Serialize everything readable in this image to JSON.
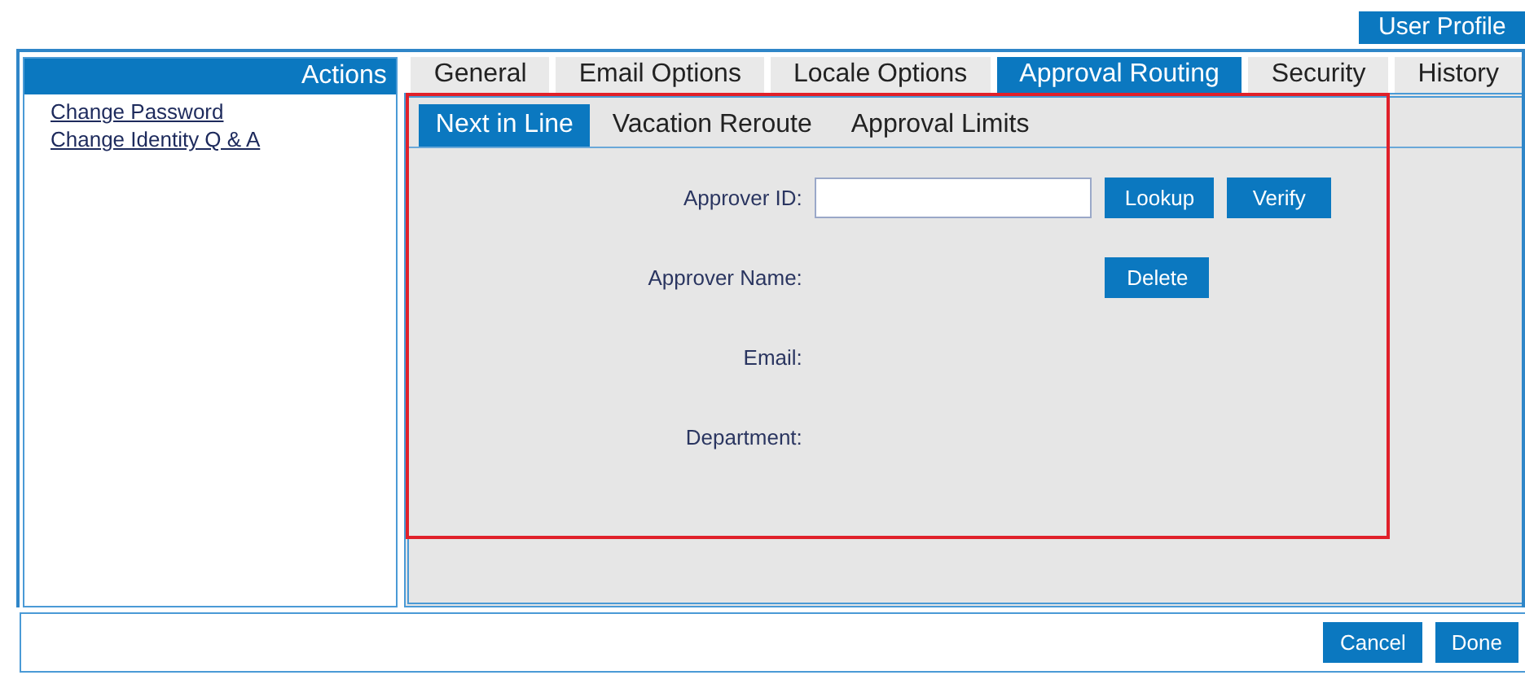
{
  "header": {
    "title": "User Profile"
  },
  "actions": {
    "title": "Actions",
    "links": [
      "Change Password",
      "Change Identity Q & A"
    ]
  },
  "tabs": [
    {
      "label": "General",
      "selected": false
    },
    {
      "label": "Email Options",
      "selected": false
    },
    {
      "label": "Locale Options",
      "selected": false
    },
    {
      "label": "Approval Routing",
      "selected": true
    },
    {
      "label": "Security",
      "selected": false
    },
    {
      "label": "History",
      "selected": false
    }
  ],
  "subtabs": [
    {
      "label": "Next in Line",
      "selected": true
    },
    {
      "label": "Vacation Reroute",
      "selected": false
    },
    {
      "label": "Approval Limits",
      "selected": false
    }
  ],
  "form": {
    "fields": [
      {
        "label": "Approver ID:",
        "kind": "input",
        "buttons": [
          "Lookup",
          "Verify"
        ]
      },
      {
        "label": "Approver Name:",
        "kind": "text",
        "buttons": [
          "Delete"
        ]
      },
      {
        "label": "Email:",
        "kind": "text"
      },
      {
        "label": "Department:",
        "kind": "text"
      }
    ]
  },
  "footer": {
    "buttons": [
      "Cancel",
      "Done"
    ]
  },
  "highlight": {
    "shown": true
  }
}
